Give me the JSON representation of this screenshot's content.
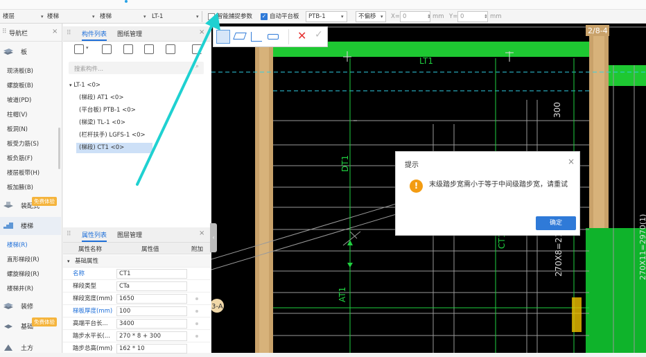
{
  "toolbar": {
    "dropdown1_value": "楼层",
    "dropdown2_value": "楼梯",
    "dropdown3_value": "楼梯",
    "dropdown4_value": "LT-1",
    "smart_snap_label": "智能捕捉参数",
    "auto_platform_label": "自动平台板",
    "platform_value": "PTB-1",
    "offset_value": "不偏移",
    "x_label": "X=",
    "x_value": "0",
    "y_label": "Y=",
    "y_value": "0",
    "unit": "mm"
  },
  "nav": {
    "title": "导航栏",
    "category_board": "板",
    "items_board": [
      "现浇板(B)",
      "螺旋板(B)",
      "坡道(PD)",
      "柱帽(V)",
      "板洞(N)",
      "板受力筋(S)",
      "板负筋(F)",
      "楼层板带(H)",
      "板加腋(B)"
    ],
    "category_assembly": "装配式",
    "free_badge": "免费体验",
    "category_stairs": "楼梯",
    "items_stairs": [
      "楼梯(R)",
      "直形梯段(R)",
      "螺旋梯段(R)",
      "楼梯井(R)"
    ],
    "category_deco": "装修",
    "category_foundation": "基础",
    "category_earth": "土方"
  },
  "component_panel": {
    "tab_list": "构件列表",
    "tab_drawing": "图纸管理",
    "search_placeholder": "搜索构件...",
    "tree_root": "LT-1 <0>",
    "tree_items": [
      "(梯段) AT1 <0>",
      "(平台板) PTB-1 <0>",
      "(梯梁) TL-1 <0>",
      "(栏杆扶手) LGFS-1 <0>",
      "(梯段) CT1 <0>"
    ]
  },
  "property_panel": {
    "tab_props": "属性列表",
    "tab_layers": "图层管理",
    "col_name": "属性名称",
    "col_value": "属性值",
    "col_extra": "附加",
    "group": "基础属性",
    "rows": [
      {
        "name": "名称",
        "value": "CT1"
      },
      {
        "name": "梯段类型",
        "value": "CTa"
      },
      {
        "name": "梯段宽度(mm)",
        "value": "1650"
      },
      {
        "name": "梯板厚度(mm)",
        "value": "100"
      },
      {
        "name": "高端平台长...",
        "value": "3400"
      },
      {
        "name": "踏步水平长(...",
        "value": "270 * 8 + 300"
      },
      {
        "name": "踏步总高(mm)",
        "value": "162 * 10"
      }
    ]
  },
  "canvas": {
    "label_grid_top": "2/8-4",
    "label_grid_left": "3-A",
    "label_300": "300",
    "label_dt1": "DT1",
    "label_ct1": "CT1",
    "label_at1": "AT1",
    "label_dim": "270X8=21",
    "label_dim_right": "270X11=2970(1)",
    "label_lt": "LT1"
  },
  "dialog": {
    "title": "提示",
    "message": "末级踏步宽需小于等于中间级踏步宽，请重试",
    "ok_label": "确定",
    "warning_color": "#f39c12",
    "accent": "#2f7ad8"
  }
}
